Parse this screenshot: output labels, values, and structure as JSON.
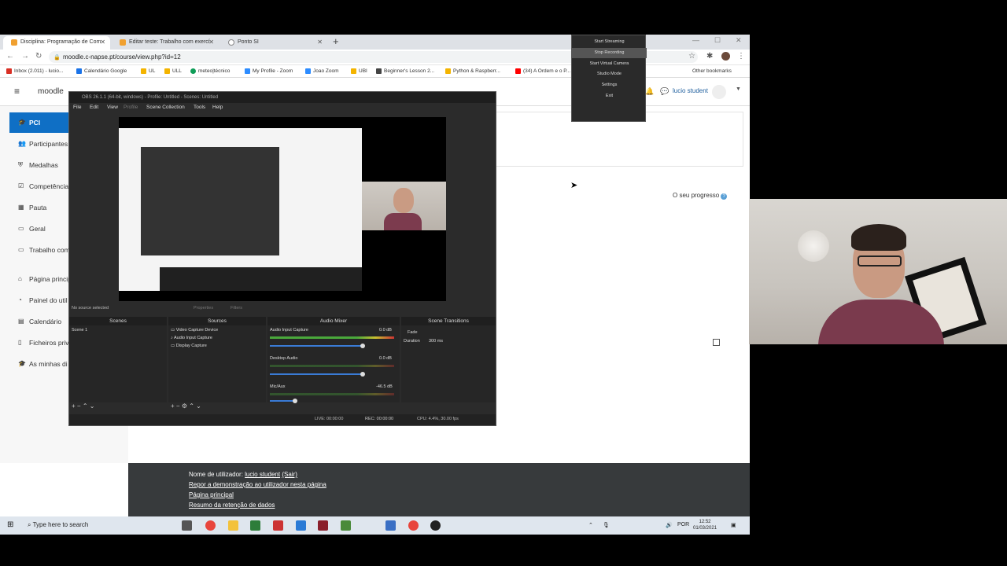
{
  "browser": {
    "tabs": [
      {
        "label": "Disciplina: Programação de Com",
        "active": true,
        "color": "#f0a030"
      },
      {
        "label": "Editar teste: Trabalho com exercí",
        "active": false,
        "color": "#f0a030"
      },
      {
        "label": "Ponto SI",
        "active": false,
        "color": "#888888"
      }
    ],
    "new_tab": "+",
    "url": "moodle.c-napse.pt/course/view.php?id=12",
    "bookmarks": [
      {
        "label": "Inbox (2.011) - lucio...",
        "color": "#d93025"
      },
      {
        "label": "Calendário Google",
        "color": "#1a73e8"
      },
      {
        "label": "UL",
        "color": "#f4b400"
      },
      {
        "label": "ULL",
        "color": "#f4b400"
      },
      {
        "label": "meteo|técnico",
        "color": "#0f9d58"
      },
      {
        "label": "My Profile - Zoom",
        "color": "#2d8cff"
      },
      {
        "label": "Joao Zoom",
        "color": "#2d8cff"
      },
      {
        "label": "UBI",
        "color": "#f4b400"
      },
      {
        "label": "Beginner's Lesson 2...",
        "color": "#444444"
      },
      {
        "label": "Python & Raspberr...",
        "color": "#f4b400"
      },
      {
        "label": "(34) A Ordem e o P...",
        "color": "#ff0000"
      }
    ],
    "other_bookmarks": "Other bookmarks"
  },
  "moodle": {
    "logo": "moodle",
    "user_name": "lucio student",
    "sidebar": [
      {
        "label": "PCI",
        "icon": "cap-icon",
        "active": true
      },
      {
        "label": "Participantes",
        "icon": "users-icon",
        "active": false
      },
      {
        "label": "Medalhas",
        "icon": "shield-icon",
        "active": false
      },
      {
        "label": "Competências",
        "icon": "check-icon",
        "active": false
      },
      {
        "label": "Pauta",
        "icon": "table-icon",
        "active": false
      },
      {
        "label": "Geral",
        "icon": "folder-icon",
        "active": false
      },
      {
        "label": "Trabalho com",
        "icon": "folder-icon",
        "active": false
      },
      {
        "label": "Página principal",
        "icon": "home-icon",
        "active": false
      },
      {
        "label": "Painel do util",
        "icon": "dashboard-icon",
        "active": false
      },
      {
        "label": "Calendário",
        "icon": "calendar-icon",
        "active": false
      },
      {
        "label": "Ficheiros priv",
        "icon": "file-icon",
        "active": false
      },
      {
        "label": "As minhas di",
        "icon": "cap-icon",
        "active": false
      }
    ],
    "progress_label": "O seu progresso",
    "footer": {
      "user_prefix": "Nome de utilizador: ",
      "user_link": "lucio student",
      "logout": "(Sair)",
      "reset_link": "Repor a demonstração ao utilizador nesta página",
      "home_link": "Página principal",
      "data_link": "Resumo da retenção de dados"
    }
  },
  "taskbar": {
    "search_placeholder": "Type here to search",
    "lang": "POR",
    "time": "12:52",
    "date": "01/03/2021"
  },
  "obs": {
    "title": "OBS 26.1.1 (64-bit, windows) - Profile: Untitled - Scenes: Untitled",
    "menu": [
      "File",
      "Edit",
      "View",
      "Profile",
      "Scene Collection",
      "Tools",
      "Help"
    ],
    "no_source": "No source selected",
    "properties": "Properties",
    "filters": "Filters",
    "docks": {
      "scenes": "Scenes",
      "sources": "Sources",
      "mixer": "Audio Mixer",
      "transitions": "Scene Transitions"
    },
    "scenes": [
      "Scene 1"
    ],
    "sources": [
      "Video Capture Device",
      "Audio Input Capture",
      "Display Capture"
    ],
    "mixer": [
      {
        "name": "Audio Input Capture",
        "db": "0.0 dB",
        "level": 0.55
      },
      {
        "name": "Desktop Audio",
        "db": "0.0 dB",
        "level": 0.0
      },
      {
        "name": "Mic/Aux",
        "db": "-46.5 dB",
        "level": 0.2
      }
    ],
    "transition": "Fade",
    "duration_label": "Duration",
    "duration": "300 ms",
    "status": {
      "live": "LIVE: 00:00:00",
      "rec": "REC: 00:00:00",
      "cpu": "CPU: 4.4%, 30.00 fps"
    }
  },
  "tray_menu": [
    {
      "label": "Start Streaming",
      "highlight": false
    },
    {
      "label": "Stop Recording",
      "highlight": true
    },
    {
      "label": "Start Virtual Camera",
      "highlight": false
    },
    {
      "label": "Studio Mode",
      "highlight": false
    },
    {
      "label": "Settings",
      "highlight": false
    },
    {
      "label": "Exit",
      "highlight": false
    }
  ]
}
